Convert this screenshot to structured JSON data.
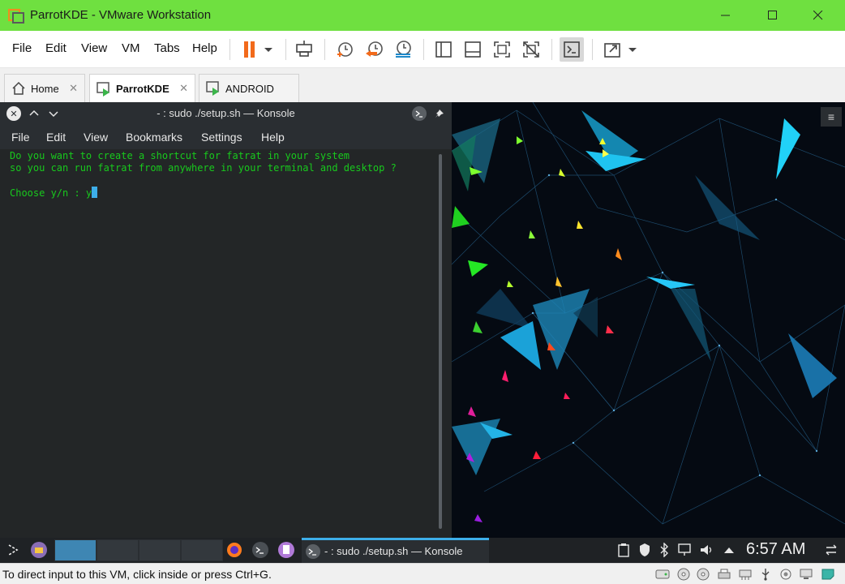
{
  "window": {
    "title": "ParrotKDE - VMware Workstation",
    "accent": "#6fe040"
  },
  "menu": {
    "file": "File",
    "edit": "Edit",
    "view": "View",
    "vm": "VM",
    "tabs": "Tabs",
    "help": "Help"
  },
  "toolbar": {
    "icons": [
      "pause-icon",
      "dropdown-icon",
      "send-ctrl-alt-del-icon",
      "snapshot-icon",
      "revert-snapshot-icon",
      "snapshot-manager-icon",
      "library-view-icon",
      "thumbnail-bar-icon",
      "full-screen-icon",
      "unity-icon",
      "console-view-icon",
      "stretch-guest-icon"
    ]
  },
  "tabs": [
    {
      "label": "Home"
    },
    {
      "label": "ParrotKDE"
    },
    {
      "label": "ANDROID"
    }
  ],
  "konsole": {
    "title": "- : sudo ./setup.sh — Konsole",
    "menu": [
      "File",
      "Edit",
      "View",
      "Bookmarks",
      "Settings",
      "Help"
    ],
    "lines": [
      "Do you want to create a shortcut for fatrat in your system",
      "so you can run fatrat from anywhere in your terminal and desktop ?",
      "",
      "Choose y/n : y"
    ],
    "text_color": "#18c91d"
  },
  "panel": {
    "task_label": "- : sudo ./setup.sh — Konsole",
    "clock": "6:57 AM"
  },
  "status": {
    "text": "To direct input to this VM, click inside or press Ctrl+G."
  }
}
